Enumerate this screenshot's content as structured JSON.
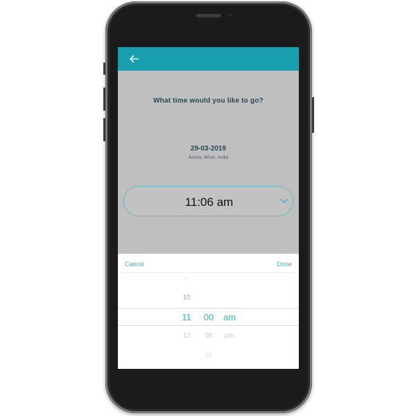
{
  "header": {
    "back_icon": "arrow-left-icon"
  },
  "content": {
    "question": "What time would you like to go?",
    "date": "29-03-2019",
    "location": "Araria, Bihar, India",
    "selected_time": "11:06 am"
  },
  "picker": {
    "cancel_label": "Cancel",
    "done_label": "Done",
    "hour_faint": "9",
    "hour_above": "10",
    "hour_selected": "11",
    "minute_selected": "00",
    "ampm_selected": "am",
    "hour_below": "12",
    "minute_below": "05",
    "ampm_below": "pm",
    "minute_far_below": "10"
  },
  "colors": {
    "accent": "#1a9fae",
    "highlight": "#2bb6c7",
    "overlay": "#bfbfbf"
  }
}
